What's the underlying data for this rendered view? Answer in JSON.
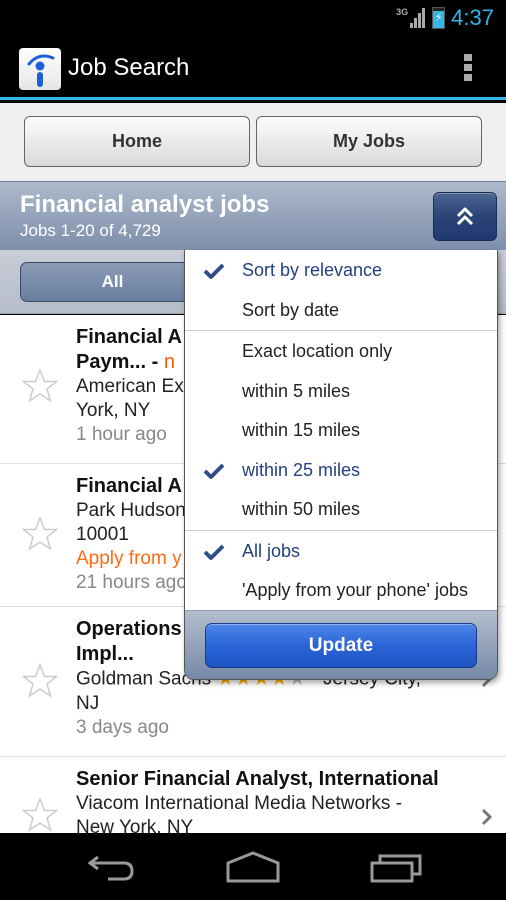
{
  "status_bar": {
    "network": "3G",
    "time": "4:37"
  },
  "action_bar": {
    "title": "Job Search",
    "icons": {
      "app": "indeed-i-logo-icon",
      "overflow": "overflow-menu-icon"
    }
  },
  "nav": {
    "home_label": "Home",
    "my_jobs_label": "My Jobs"
  },
  "search": {
    "title": "Financial analyst jobs",
    "count": "Jobs 1-20 of 4,729",
    "collapse_icon": "double-chevron-up-icon"
  },
  "filter_tabs": {
    "active_label": "All"
  },
  "jobs": [
    {
      "title": "Financial A",
      "title_line2": "Paym...",
      "new_badge": "n",
      "company_line1": "American Ex",
      "company_line2": "York, NY",
      "age": "1 hour ago",
      "saved": false
    },
    {
      "title": "Financial A",
      "company_line1": "Park Hudson",
      "company_line2": "10001",
      "apply_note": "Apply from y",
      "age": "21 hours ago",
      "saved": false
    },
    {
      "title": "Operations",
      "title_line2": "Impl...",
      "company": "Goldman Sachs",
      "rating": 4,
      "rating_max": 5,
      "location": "Jersey City,",
      "location_line2": "NJ",
      "age": "3 days ago",
      "saved": false
    },
    {
      "title": "Senior Financial Analyst, International",
      "company_line1": "Viacom International Media Networks -",
      "company_line2": "New York, NY",
      "saved": false
    }
  ],
  "sort_popup": {
    "sort_options": [
      {
        "label": "Sort by relevance",
        "checked": true
      },
      {
        "label": "Sort by date",
        "checked": false
      }
    ],
    "distance_options": [
      {
        "label": "Exact location only",
        "checked": false
      },
      {
        "label": "within 5 miles",
        "checked": false
      },
      {
        "label": "within 15 miles",
        "checked": false
      },
      {
        "label": "within 25 miles",
        "checked": true
      },
      {
        "label": "within 50 miles",
        "checked": false
      }
    ],
    "job_type_options": [
      {
        "label": "All jobs",
        "checked": true
      },
      {
        "label": "'Apply from your phone' jobs",
        "checked": false
      }
    ],
    "update_label": "Update"
  },
  "system_nav": {
    "back": "back-icon",
    "home": "home-icon",
    "recents": "recent-apps-icon"
  },
  "colors": {
    "accent_blue": "#33b5e5",
    "checked_text": "#23417f",
    "new_orange": "#ff5a00",
    "star_gold": "#ffb400",
    "update_button": "#2a64d6"
  }
}
